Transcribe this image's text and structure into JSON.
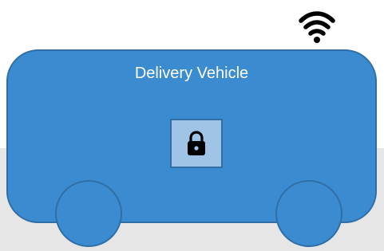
{
  "vehicle": {
    "label": "Delivery Vehicle"
  },
  "icons": {
    "connectivity": "wifi-icon",
    "security": "lock-icon"
  },
  "colors": {
    "body": "#3b8bd0",
    "outline": "#2f6fa6",
    "lock_panel": "#9fc4e6",
    "ground": "#e6e6e6",
    "label_text": "#ffffff",
    "icon": "#000000"
  }
}
